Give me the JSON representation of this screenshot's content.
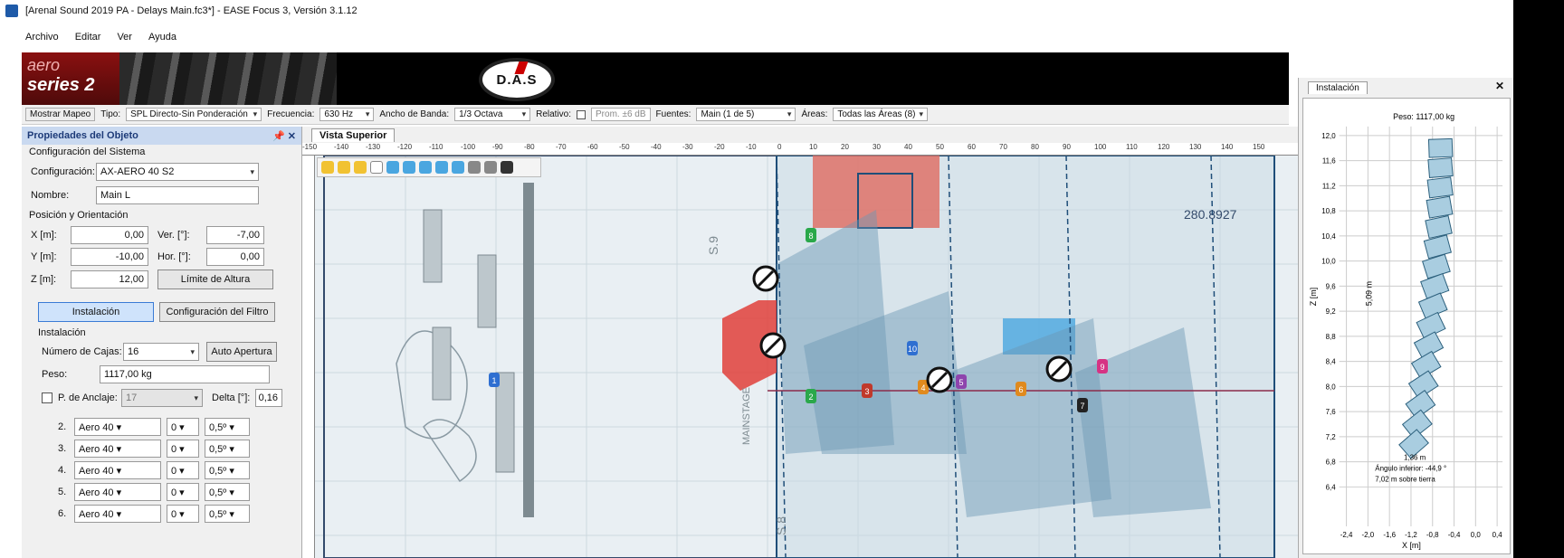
{
  "window": {
    "title": "[Arenal Sound 2019 PA - Delays Main.fc3*] - EASE Focus 3, Versión 3.1.12"
  },
  "menu": [
    "Archivo",
    "Editar",
    "Ver",
    "Ayuda"
  ],
  "banner": {
    "aero_line1": "aero",
    "aero_line2": "series 2",
    "das_logo": "D.A.S"
  },
  "toolbar": {
    "mapping_button": "Mostrar Mapeo",
    "type_label": "Tipo:",
    "type_value": "SPL Directo-Sin Ponderación",
    "freq_label": "Frecuencia:",
    "freq_value": "630 Hz",
    "bandwidth_label": "Ancho de Banda:",
    "bandwidth_value": "1/3 Octava",
    "relative_label": "Relativo:",
    "relative_value": "Prom. ±6 dB",
    "sources_label": "Fuentes:",
    "sources_value": "Main (1 de 5)",
    "areas_label": "Áreas:",
    "areas_value": "Todas las Áreas (8)"
  },
  "properties": {
    "header": "Propiedades del Objeto",
    "system_section": "Configuración del Sistema",
    "config_label": "Configuración:",
    "config_value": "AX-AERO 40 S2",
    "name_label": "Nombre:",
    "name_value": "Main L",
    "position_section": "Posición y Orientación",
    "x_label": "X [m]:",
    "x_value": "0,00",
    "y_label": "Y [m]:",
    "y_value": "-10,00",
    "z_label": "Z [m]:",
    "z_value": "12,00",
    "ver_label": "Ver. [°]:",
    "ver_value": "-7,00",
    "hor_label": "Hor. [°]:",
    "hor_value": "0,00",
    "height_limit_button": "Límite de Altura",
    "install_button": "Instalación",
    "filter_button": "Configuración del Filtro",
    "install_section": "Instalación",
    "boxes_label": "Número de Cajas:",
    "boxes_value": "16",
    "auto_button": "Auto Apertura",
    "weight_label": "Peso:",
    "weight_value": "1117,00 kg",
    "anchor_label": "P. de Anclaje:",
    "anchor_value": "17",
    "delta_label": "Delta [°]:",
    "delta_value": "0,16",
    "boxes": [
      {
        "n": "2.",
        "model": "Aero 40",
        "v": "0",
        "angle": "0,5º"
      },
      {
        "n": "3.",
        "model": "Aero 40",
        "v": "0",
        "angle": "0,5º"
      },
      {
        "n": "4.",
        "model": "Aero 40",
        "v": "0",
        "angle": "0,5º"
      },
      {
        "n": "5.",
        "model": "Aero 40",
        "v": "0",
        "angle": "0,5º"
      },
      {
        "n": "6.",
        "model": "Aero 40",
        "v": "0",
        "angle": "0,5º"
      }
    ]
  },
  "view": {
    "tab": "Vista Superior",
    "ruler_top": [
      "-150",
      "-140",
      "-130",
      "-120",
      "-110",
      "-100",
      "-90",
      "-80",
      "-70",
      "-60",
      "-50",
      "-40",
      "-30",
      "-20",
      "-10",
      "0",
      "10",
      "20",
      "30",
      "40",
      "50",
      "60",
      "70",
      "80",
      "90",
      "100",
      "110",
      "120",
      "130",
      "140",
      "150"
    ],
    "dimension_label": "280.8927",
    "stage_text": "MAINSTAGE",
    "s_label": "S.9",
    "s_label2": "S.8",
    "markers": [
      "1",
      "2",
      "3",
      "4",
      "5",
      "6",
      "7",
      "8",
      "9",
      "10"
    ]
  },
  "install_panel": {
    "tab": "Instalación",
    "weight": "Peso: 1117,00 kg",
    "y_axis_label": "Z [m]",
    "x_axis_label": "X [m]",
    "y_ticks": [
      "12,0",
      "11,6",
      "11,2",
      "10,8",
      "10,4",
      "10,0",
      "9,6",
      "9,2",
      "8,8",
      "8,4",
      "8,0",
      "7,6",
      "7,2",
      "6,8",
      "6,4"
    ],
    "x_ticks": [
      "-2,4",
      "-2,0",
      "-1,6",
      "-1,2",
      "-0,8",
      "-0,4",
      "0,0",
      "0,4"
    ],
    "height_annot": "5,09 m",
    "width_annot": "1,36 m",
    "lower_angle": "Ángulo inferior: -44,9 °",
    "above_ground": "7,02 m sobre tierra"
  },
  "colors": {
    "accent": "#3a7bd5",
    "panel_header": "#c9d9f0",
    "coverage": "#8fb3c8",
    "stage_red": "#e0403a"
  }
}
